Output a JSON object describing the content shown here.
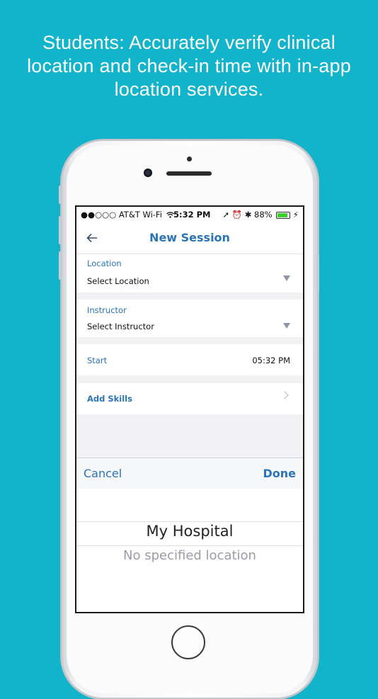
{
  "headline": {
    "line1": "Students:  Accurately verify clinical",
    "line2": "location and check-in time with in-app",
    "line3": "location services."
  },
  "status_bar": {
    "carrier": "●●○○○ AT&T Wi-Fi",
    "wifi_icon": "wifi-icon",
    "time": "5:32 PM",
    "indicators": "➚ ⏰ ✱",
    "battery_percent": "88%",
    "battery_level": 0.88
  },
  "nav": {
    "back_icon": "back-arrow-icon",
    "title": "New Session"
  },
  "form": {
    "location": {
      "label": "Location",
      "value": "Select Location"
    },
    "instructor": {
      "label": "Instructor",
      "value": "Select Instructor"
    },
    "start": {
      "label": "Start",
      "value": "05:32 PM"
    },
    "add_skills": {
      "label": "Add Skills"
    }
  },
  "picker": {
    "cancel_label": "Cancel",
    "done_label": "Done",
    "selected": "My Hospital",
    "options": [
      "No specified location"
    ]
  },
  "colors": {
    "background": "#12b4cc",
    "accent": "#2b74b8"
  }
}
